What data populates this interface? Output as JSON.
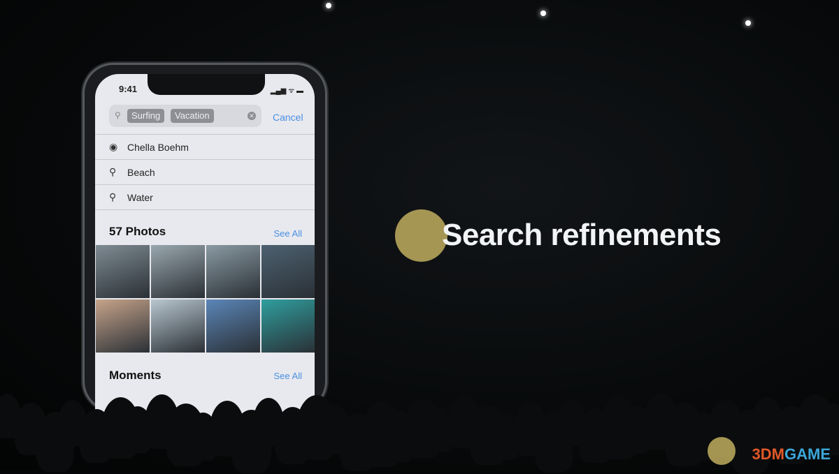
{
  "phone": {
    "status_time": "9:41",
    "search": {
      "tokens": [
        "Surfing",
        "Vacation"
      ],
      "cancel_label": "Cancel"
    },
    "suggestions": [
      {
        "icon": "person-circle-icon",
        "label": "Chella Boehm"
      },
      {
        "icon": "search-icon",
        "label": "Beach"
      },
      {
        "icon": "search-icon",
        "label": "Water"
      }
    ],
    "photos": {
      "title": "57 Photos",
      "see_all": "See All",
      "thumbs": [
        "#7f8b93",
        "#9aa7ae",
        "#8a9aa3",
        "#4d6170",
        "#c7a48a",
        "#b9c7d0",
        "#5b86b8",
        "#2f9e9e"
      ]
    },
    "moments": {
      "title": "Moments",
      "see_all": "See All"
    }
  },
  "slide": {
    "headline": "Search refinements"
  },
  "watermark": {
    "text": "3DMGAME",
    "colors": {
      "3DM": "#e0582a",
      "GAME": "#3aa6d8"
    }
  }
}
